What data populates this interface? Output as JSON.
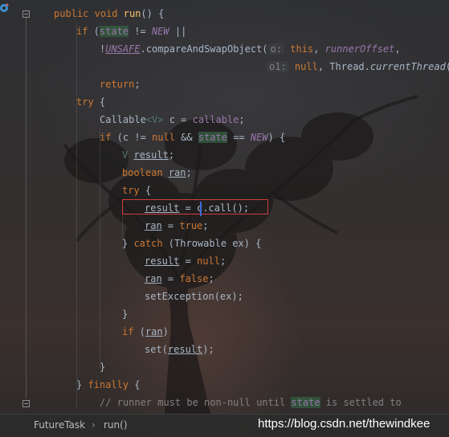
{
  "gutter": {
    "run_marker_icon": "override-run-icon"
  },
  "code": {
    "l1": {
      "kw1": "public",
      "kw2": "void",
      "fn": "run",
      "rest": "() {"
    },
    "l2": {
      "kw": "if",
      "p1": " (",
      "fld": "state",
      "p2": " != ",
      "const": "NEW",
      "p3": " ||"
    },
    "l3": {
      "p1": "!",
      "sf": "UNSAFE",
      "p2": ".compareAndSwapObject(",
      "hint": "o:",
      "kw": "this",
      "c": ",",
      "fld": "runnerOffset",
      "c2": ","
    },
    "l4": {
      "hint": "o1:",
      "kw": "null",
      "c": ",",
      "cls": "Thread.",
      "it": "currentThread",
      "p": "()"
    },
    "l5": {
      "kw": "return",
      "p": ";"
    },
    "l6": {
      "kw": "try",
      "p": " {"
    },
    "l7": {
      "p1": "Callable",
      "tp": "<V>",
      "p2": " c = ",
      "fld": "callable",
      "p3": ";"
    },
    "l8": {
      "kw": "if",
      "p1": " (c != ",
      "kw2": "null",
      "p2": " && ",
      "fld": "state",
      "p3": " == ",
      "const": "NEW",
      "p4": ") {"
    },
    "l9": {
      "tp": "V",
      "var": "result",
      "p": ";"
    },
    "l10": {
      "kw": "boolean",
      "var": "ran",
      "p": ";"
    },
    "l11": {
      "kw": "try",
      "p": " {"
    },
    "l12": {
      "var": "result",
      "p1": " = ",
      "p2": "c",
      "p3": ".call();"
    },
    "l13": {
      "var": "ran",
      "p1": " = ",
      "kw": "true",
      "p2": ";"
    },
    "l14": {
      "p1": "} ",
      "kw": "catch",
      "p2": " (Throwable ex) {"
    },
    "l15": {
      "var": "result",
      "p1": " = ",
      "kw": "null",
      "p2": ";"
    },
    "l16": {
      "var": "ran",
      "p1": " = ",
      "kw": "false",
      "p2": ";"
    },
    "l17": {
      "p": "setException(ex);"
    },
    "l18": {
      "p": "}"
    },
    "l19": {
      "kw": "if",
      "p1": " (",
      "var": "ran",
      "p2": ")"
    },
    "l20": {
      "p1": "set(",
      "var": "result",
      "p2": ");"
    },
    "l21": {
      "p": "}"
    },
    "l22": {
      "p1": "} ",
      "kw": "finally",
      "p2": " {"
    },
    "l23": {
      "c1": "// runner must be non-null until ",
      "fld": "state",
      "c2": " is settled to"
    }
  },
  "breadcrumb": {
    "class_name": "FutureTask",
    "separator": "›",
    "method": "run()"
  },
  "watermark": "https://blog.csdn.net/thewindkee",
  "colors": {
    "keyword": "#cc7832",
    "method": "#ffc66d",
    "plain": "#a9b7c6",
    "field": "#9876aa",
    "comment": "#808080",
    "highlight": "#32593d",
    "selection_box": "#d23c3c",
    "caret": "#3b6bdf"
  }
}
